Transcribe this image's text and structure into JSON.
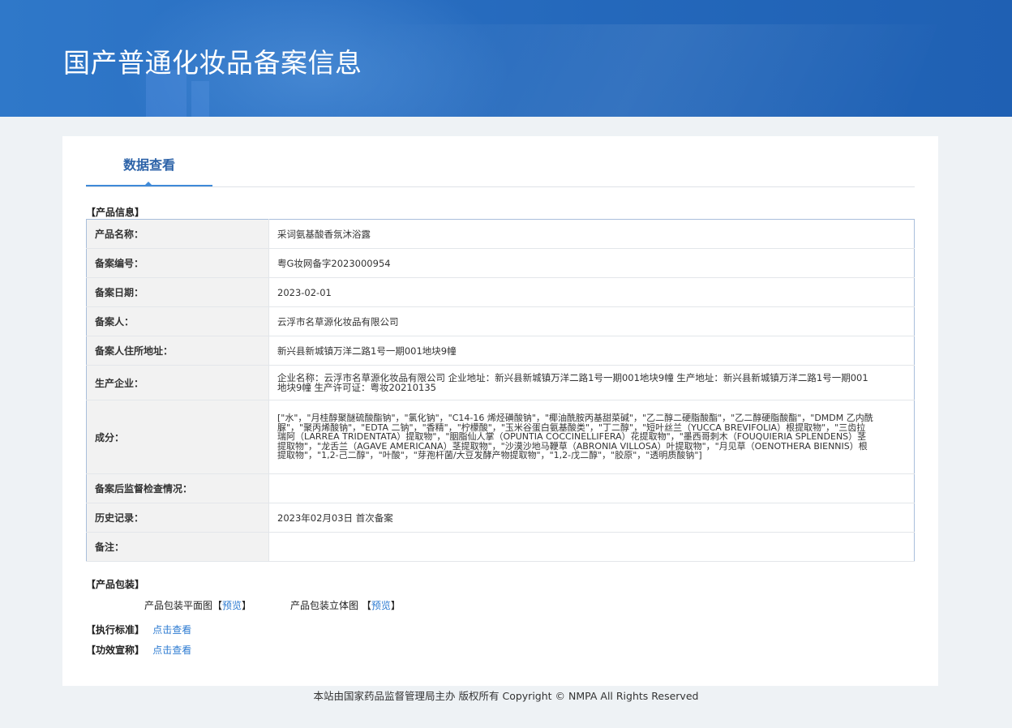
{
  "header": {
    "title": "国产普通化妆品备案信息"
  },
  "tabs": [
    {
      "label": "数据查看"
    }
  ],
  "product_section": {
    "label": "【产品信息】",
    "rows": [
      {
        "key": "产品名称：",
        "value": "采词氨基酸香氛沐浴露"
      },
      {
        "key": "备案编号：",
        "value": "粤G妆网备字2023000954"
      },
      {
        "key": "备案日期：",
        "value": "2023-02-01"
      },
      {
        "key": "备案人：",
        "value": "云浮市名草源化妆品有限公司"
      },
      {
        "key": "备案人住所地址：",
        "value": "新兴县新城镇万洋二路1号一期001地块9幢"
      },
      {
        "key": "生产企业：",
        "value": "企业名称：云浮市名草源化妆品有限公司 企业地址：新兴县新城镇万洋二路1号一期001地块9幢 生产地址：新兴县新城镇万洋二路1号一期001地块9幢 生产许可证：粤妆20210135"
      },
      {
        "key": "成分：",
        "value": "[\"水\"，\"月桂醇聚醚硫酸酯钠\"，\"氯化钠\"，\"C14-16 烯烃磺酸钠\"，\"椰油酰胺丙基甜菜碱\"，\"乙二醇二硬脂酸酯\"，\"乙二醇硬脂酸酯\"，\"DMDM 乙内酰脲\"，\"聚丙烯酸钠\"，\"EDTA 二钠\"，\"香精\"，\"柠檬酸\"，\"玉米谷蛋白氨基酸类\"，\"丁二醇\"，\"短叶丝兰（YUCCA BREVIFOLIA）根提取物\"，\"三齿拉瑞阿（LARREA TRIDENTATA）提取物\"，\"胭脂仙人掌（OPUNTIA COCCINELLIFERA）花提取物\"，\"墨西哥刺木（FOUQUIERIA SPLENDENS）茎提取物\"，\"龙舌兰（AGAVE AMERICANA）茎提取物\"，\"沙漠沙地马鞭草（ABRONIA VILLOSA）叶提取物\"，\"月见草（OENOTHERA BIENNIS）根提取物\"，\"1,2-己二醇\"，\"叶酸\"，\"芽孢杆菌/大豆发酵产物提取物\"，\"1,2-戊二醇\"，\"胶原\"，\"透明质酸钠\"]"
      },
      {
        "key": "备案后监督检查情况：",
        "value": ""
      },
      {
        "key": "历史记录：",
        "value": "2023年02月03日 首次备案"
      },
      {
        "key": "备注：",
        "value": ""
      }
    ]
  },
  "package_section": {
    "label": "【产品包装】",
    "flat_label": "产品包装平面图",
    "solid_label": "产品包装立体图",
    "bracket_open": "【",
    "bracket_close": "】",
    "preview": "预览"
  },
  "standard_section": {
    "label": "【执行标准】",
    "link": "点击查看"
  },
  "efficacy_section": {
    "label": "【功效宣称】",
    "link": "点击查看"
  },
  "footer": {
    "text": "本站由国家药品监督管理局主办 版权所有 Copyright © NMPA All Rights Reserved"
  }
}
